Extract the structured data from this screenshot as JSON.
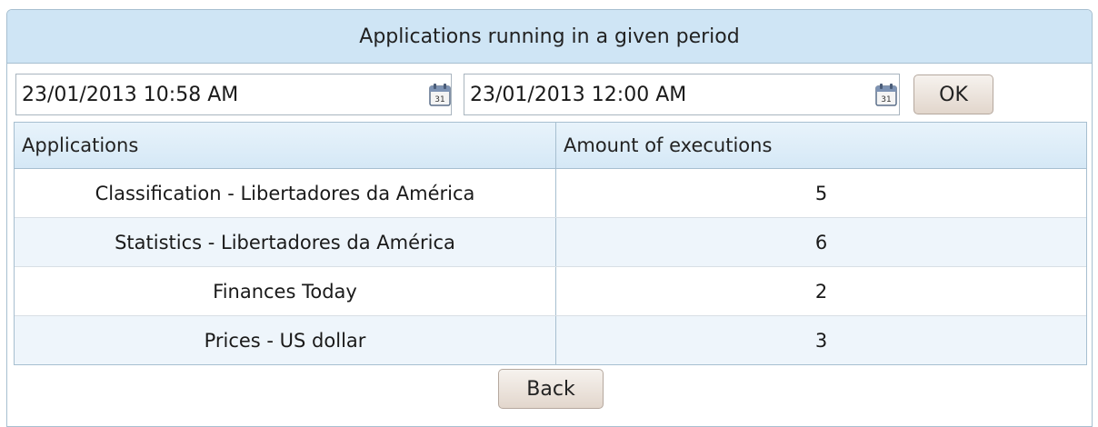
{
  "panel": {
    "title": "Applications running in a given period"
  },
  "filters": {
    "start_date": "23/01/2013 10:58 AM",
    "end_date": "23/01/2013 12:00 AM",
    "ok_label": "OK",
    "calendar_icon": "calendar-icon"
  },
  "table": {
    "headers": [
      "Applications",
      "Amount of executions"
    ],
    "rows": [
      {
        "application": "Classification - Libertadores da América",
        "executions": "5"
      },
      {
        "application": "Statistics - Libertadores da América",
        "executions": "6"
      },
      {
        "application": "Finances Today",
        "executions": "2"
      },
      {
        "application": "Prices - US dollar",
        "executions": "3"
      }
    ]
  },
  "footer": {
    "back_label": "Back"
  },
  "colors": {
    "header_bg": "#cfe5f5",
    "border": "#a7bfd0",
    "alt_row": "#eef5fb",
    "button_bg": "#e2d6cc"
  }
}
